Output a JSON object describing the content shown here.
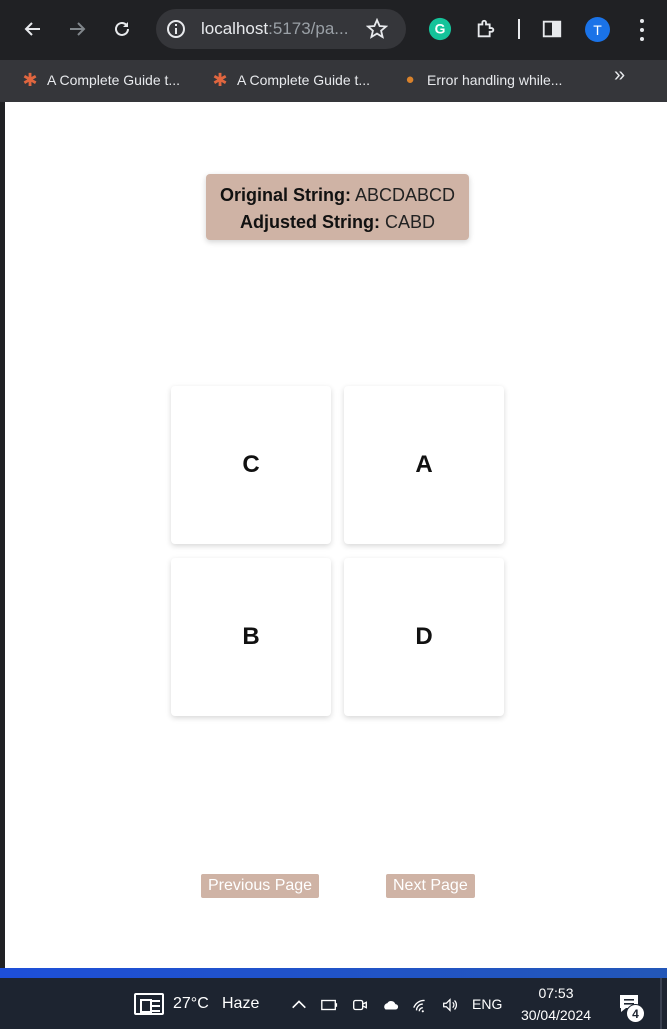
{
  "browser": {
    "url_host": "localhost",
    "url_rest": ":5173/pa...",
    "avatar_letter": "T",
    "bookmarks": [
      {
        "label": "A Complete Guide t...",
        "icon": "asterisk-icon"
      },
      {
        "label": "A Complete Guide t...",
        "icon": "asterisk-icon"
      },
      {
        "label": "Error handling while...",
        "icon": "owl-icon"
      }
    ],
    "more_bookmarks": "»"
  },
  "info": {
    "original_label": "Original String:",
    "original_value": " ABCDABCD",
    "adjusted_label": "Adjusted String:",
    "adjusted_value": " CABD"
  },
  "cards": [
    "C",
    "A",
    "B",
    "D"
  ],
  "pager": {
    "prev_label": "Previous Page",
    "next_label": "Next Page"
  },
  "taskbar": {
    "temperature": "27°C",
    "weather": "Haze",
    "language": "ENG",
    "time": "07:53",
    "date": "30/04/2024",
    "notification_count": "4"
  },
  "colors": {
    "accent": "#cfb3a5",
    "chrome_dark": "#202124",
    "taskbar": "#1d2430"
  }
}
